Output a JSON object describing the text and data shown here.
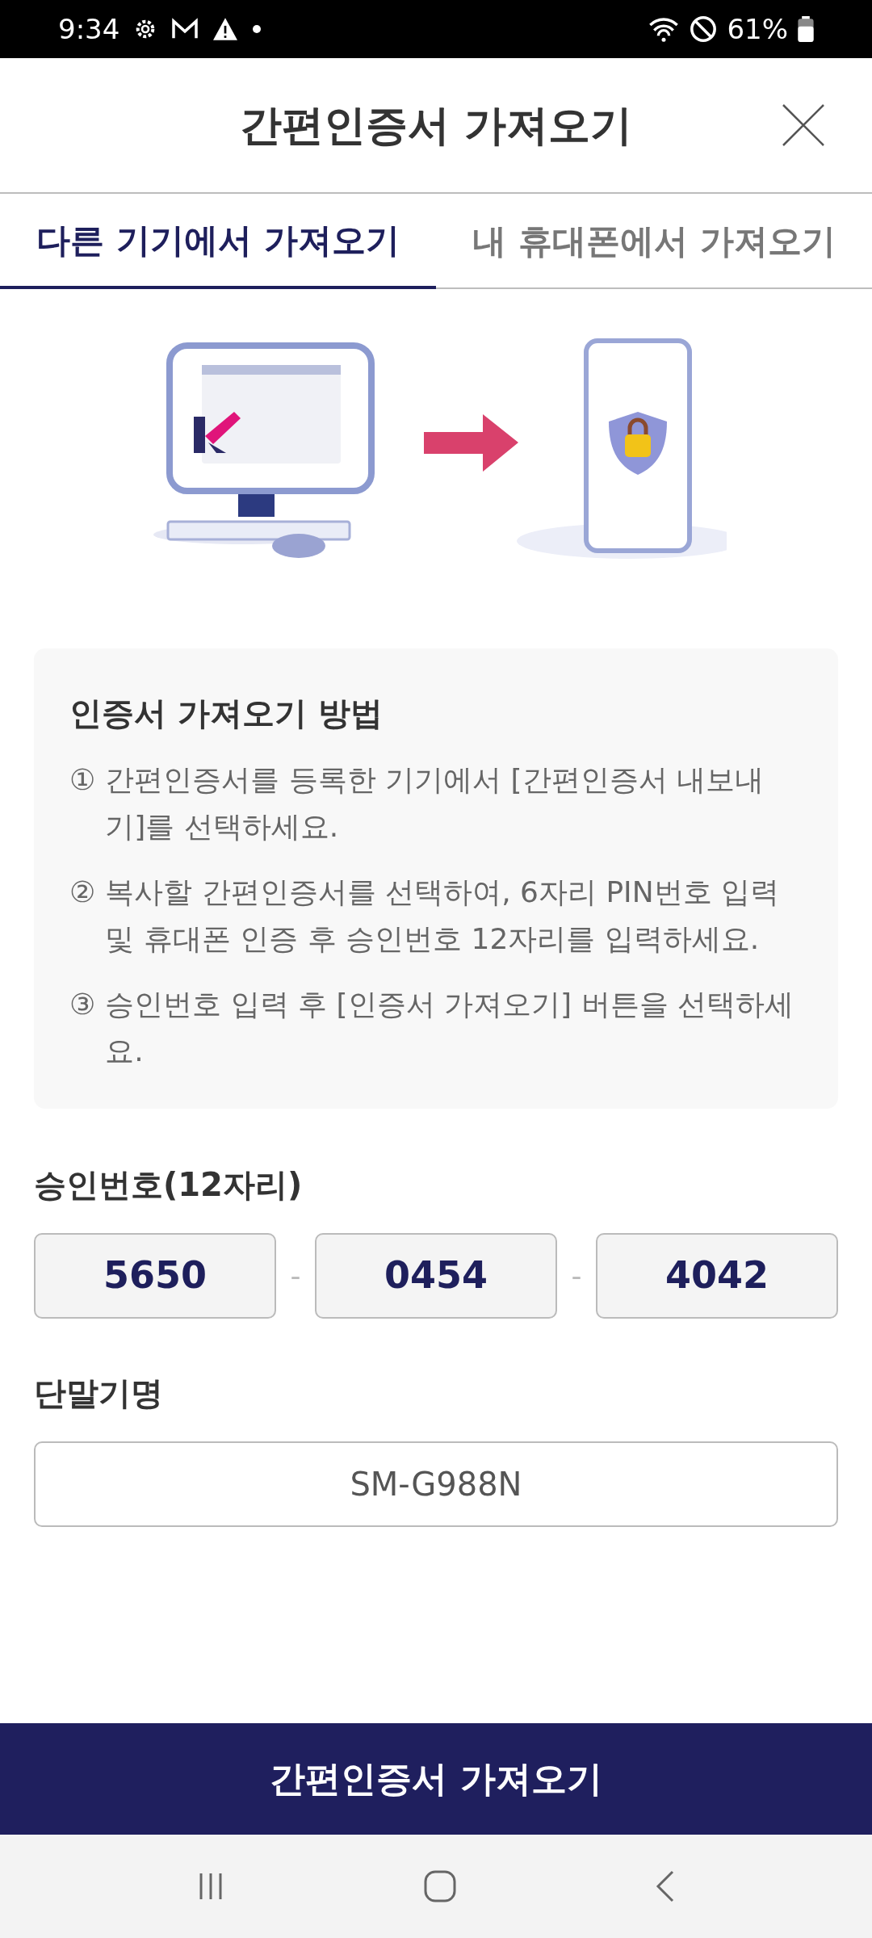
{
  "status_bar": {
    "time": "9:34",
    "battery": "61%"
  },
  "header": {
    "title": "간편인증서 가져오기"
  },
  "tabs": [
    {
      "label": "다른 기기에서 가져오기",
      "selected": true
    },
    {
      "label": "내 휴대폰에서 가져오기",
      "selected": false
    }
  ],
  "guide": {
    "title": "인증서 가져오기 방법",
    "steps": [
      {
        "marker": "①",
        "text": "간편인증서를 등록한 기기에서 [간편인증서 내보내기]를 선택하세요."
      },
      {
        "marker": "②",
        "text": "복사할 간편인증서를 선택하여, 6자리 PIN번호 입력 및 휴대폰 인증 후 승인번호 12자리를 입력하세요."
      },
      {
        "marker": "③",
        "text": "승인번호 입력 후 [인증서 가져오기] 버튼을 선택하세요."
      }
    ]
  },
  "approval": {
    "label": "승인번호(12자리)",
    "parts": [
      "5650",
      "0454",
      "4042"
    ],
    "separator": "-"
  },
  "device": {
    "label": "단말기명",
    "value": "SM-G988N"
  },
  "submit_button": "간편인증서 가져오기"
}
